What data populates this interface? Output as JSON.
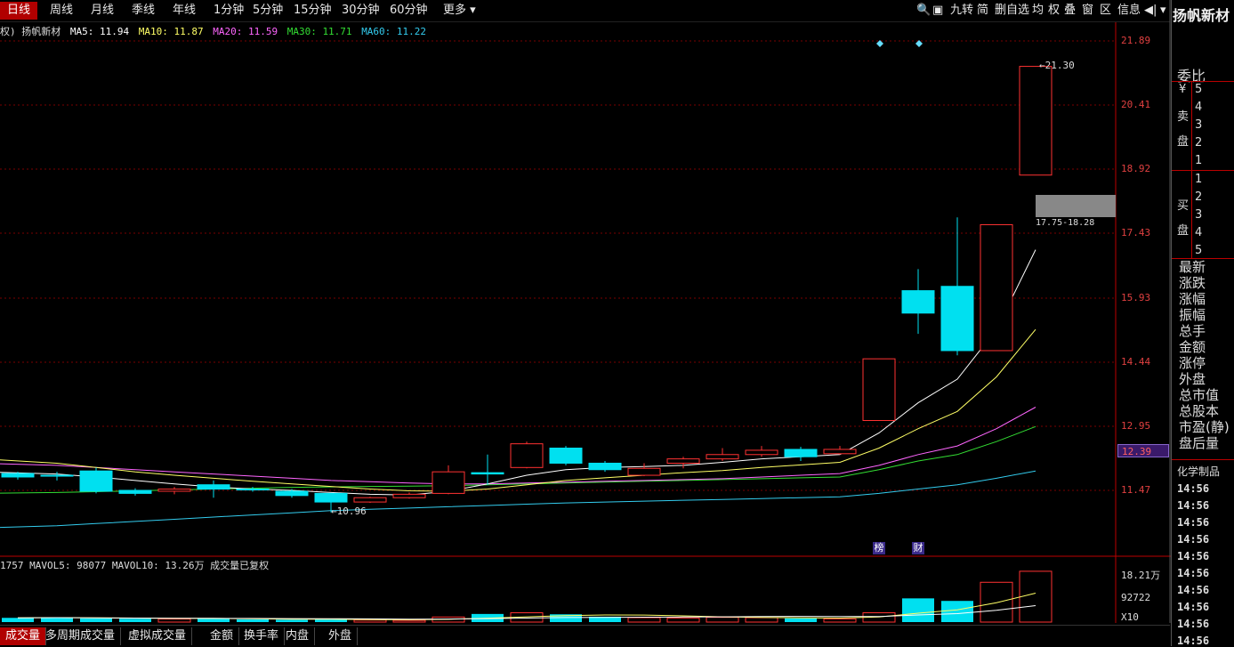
{
  "topbar": {
    "tabs": [
      "日线",
      "周线",
      "月线",
      "季线",
      "年线",
      "1分钟",
      "5分钟",
      "15分钟",
      "30分钟",
      "60分钟",
      "更多 ▾"
    ],
    "tools": [
      "🔍",
      "▣",
      "九转",
      "简",
      "删自选",
      "均",
      "权",
      "叠",
      "窗",
      "区",
      "信息",
      "◀|",
      "▾"
    ]
  },
  "stock": {
    "name": "扬帆新材"
  },
  "ma": {
    "prefix": "权) 扬帆新材",
    "ma5": "MA5: 11.94",
    "ma10": "MA10: 11.87",
    "ma20": "MA20: 11.59",
    "ma30": "MA30: 11.71",
    "ma60": "MA60: 11.22",
    "colors": {
      "ma5": "#ffffff",
      "ma10": "#ffff66",
      "ma20": "#ff66ff",
      "ma30": "#33dd33",
      "ma60": "#33ccee"
    }
  },
  "axis": {
    "price_labels": [
      "21.89",
      "20.41",
      "18.92",
      "17.43",
      "15.93",
      "14.44",
      "12.95",
      "11.47"
    ],
    "current_price": "12.39",
    "vol_labels": [
      "18.21万",
      "92722",
      "X10"
    ]
  },
  "annotations": {
    "high_label": "21.30",
    "low_label": "10.96",
    "range_label": "17.75-18.28",
    "bang": "榜",
    "cai": "财"
  },
  "volume": {
    "label": "1757 MAVOL5: 98077 MAVOL10: 13.26万 成交量已复权"
  },
  "bottom_tabs": [
    "成交量",
    "多周期成交量",
    "虚拟成交量",
    "金额",
    "换手率",
    "内盘",
    "外盘"
  ],
  "right_panel": {
    "title": "委比",
    "yen": "¥",
    "sell": [
      "卖",
      "盘"
    ],
    "buy": [
      "买",
      "盘"
    ],
    "sell_levels": [
      "5",
      "4",
      "3",
      "2",
      "1"
    ],
    "buy_levels": [
      "1",
      "2",
      "3",
      "4",
      "5"
    ],
    "fields": [
      "最新",
      "涨跌",
      "涨幅",
      "振幅",
      "总手",
      "金额",
      "涨停",
      "外盘",
      "总市值",
      "总股本",
      "市盈(静)",
      "盘后量"
    ],
    "sector": "化学制品",
    "times": [
      "14:56",
      "14:56",
      "14:56",
      "14:56",
      "14:56",
      "14:56",
      "14:56",
      "14:56",
      "14:56",
      "14:56"
    ]
  },
  "chart_data": {
    "type": "candlestick",
    "ylim": [
      10.0,
      22.5
    ],
    "candles": [
      {
        "o": 11.86,
        "c": 11.78,
        "h": 11.9,
        "l": 11.72
      },
      {
        "o": 11.82,
        "c": 11.8,
        "h": 11.9,
        "l": 11.7
      },
      {
        "o": 11.92,
        "c": 11.45,
        "h": 12.0,
        "l": 11.4
      },
      {
        "o": 11.47,
        "c": 11.4,
        "h": 11.52,
        "l": 11.35
      },
      {
        "o": 11.45,
        "c": 11.5,
        "h": 11.55,
        "l": 11.38
      },
      {
        "o": 11.6,
        "c": 11.5,
        "h": 11.7,
        "l": 11.3
      },
      {
        "o": 11.5,
        "c": 11.48,
        "h": 11.55,
        "l": 11.44
      },
      {
        "o": 11.45,
        "c": 11.35,
        "h": 11.5,
        "l": 11.3
      },
      {
        "o": 11.4,
        "c": 11.2,
        "h": 11.4,
        "l": 10.96
      },
      {
        "o": 11.2,
        "c": 11.3,
        "h": 11.32,
        "l": 11.18
      },
      {
        "o": 11.3,
        "c": 11.38,
        "h": 11.42,
        "l": 11.28
      },
      {
        "o": 11.4,
        "c": 11.9,
        "h": 12.05,
        "l": 11.38
      },
      {
        "o": 11.88,
        "c": 11.85,
        "h": 12.3,
        "l": 11.6
      },
      {
        "o": 12.0,
        "c": 12.55,
        "h": 12.6,
        "l": 11.98
      },
      {
        "o": 12.45,
        "c": 12.1,
        "h": 12.5,
        "l": 12.05
      },
      {
        "o": 12.1,
        "c": 11.95,
        "h": 12.15,
        "l": 11.9
      },
      {
        "o": 11.82,
        "c": 11.98,
        "h": 12.1,
        "l": 11.8
      },
      {
        "o": 12.1,
        "c": 12.2,
        "h": 12.25,
        "l": 11.98
      },
      {
        "o": 12.2,
        "c": 12.3,
        "h": 12.45,
        "l": 12.15
      },
      {
        "o": 12.3,
        "c": 12.4,
        "h": 12.5,
        "l": 12.25
      },
      {
        "o": 12.42,
        "c": 12.25,
        "h": 12.48,
        "l": 12.15
      },
      {
        "o": 12.32,
        "c": 12.42,
        "h": 12.5,
        "l": 12.3
      },
      {
        "o": 13.09,
        "c": 14.52,
        "h": 14.52,
        "l": 13.09
      },
      {
        "o": 16.1,
        "c": 15.58,
        "h": 16.6,
        "l": 15.1
      },
      {
        "o": 16.2,
        "c": 14.71,
        "h": 17.8,
        "l": 14.6
      },
      {
        "o": 14.71,
        "c": 17.63,
        "h": 17.63,
        "l": 14.71
      },
      {
        "o": 18.78,
        "c": 21.3,
        "h": 21.3,
        "l": 18.78
      }
    ],
    "ma5": [
      11.9,
      11.85,
      11.78,
      11.7,
      11.62,
      11.55,
      11.5,
      11.47,
      11.42,
      11.38,
      11.36,
      11.45,
      11.62,
      11.82,
      11.95,
      12.0,
      12.02,
      12.05,
      12.12,
      12.2,
      12.25,
      12.3,
      12.8,
      13.5,
      14.05,
      15.2,
      17.05
    ],
    "ma10": [
      12.2,
      12.1,
      12.0,
      11.9,
      11.82,
      11.75,
      11.68,
      11.62,
      11.56,
      11.5,
      11.46,
      11.45,
      11.5,
      11.6,
      11.7,
      11.76,
      11.82,
      11.88,
      11.93,
      12.0,
      12.06,
      12.12,
      12.45,
      12.9,
      13.3,
      14.1,
      15.2
    ],
    "ma20": [
      12.1,
      12.05,
      12.0,
      11.95,
      11.9,
      11.85,
      11.8,
      11.75,
      11.7,
      11.67,
      11.64,
      11.62,
      11.62,
      11.64,
      11.66,
      11.68,
      11.7,
      11.72,
      11.74,
      11.78,
      11.82,
      11.86,
      12.05,
      12.3,
      12.5,
      12.9,
      13.4
    ],
    "ma30": [
      11.4,
      11.42,
      11.44,
      11.46,
      11.48,
      11.5,
      11.52,
      11.54,
      11.55,
      11.56,
      11.57,
      11.58,
      11.6,
      11.62,
      11.64,
      11.66,
      11.68,
      11.7,
      11.72,
      11.74,
      11.76,
      11.78,
      11.95,
      12.15,
      12.3,
      12.6,
      12.95
    ],
    "ma60": [
      10.6,
      10.65,
      10.7,
      10.75,
      10.8,
      10.85,
      10.9,
      10.95,
      11.0,
      11.03,
      11.06,
      11.09,
      11.12,
      11.15,
      11.18,
      11.2,
      11.22,
      11.24,
      11.26,
      11.28,
      11.3,
      11.32,
      11.4,
      11.5,
      11.6,
      11.75,
      11.92
    ],
    "volume": [
      2.5,
      2.8,
      2.2,
      2.0,
      1.8,
      2.0,
      1.6,
      1.4,
      1.5,
      1.2,
      1.0,
      3.0,
      4.8,
      5.5,
      4.6,
      3.2,
      2.6,
      2.4,
      2.8,
      2.6,
      2.2,
      1.9,
      5.5,
      14.0,
      12.5,
      23.5,
      30.0
    ],
    "vol_ylim": [
      0,
      31
    ]
  }
}
